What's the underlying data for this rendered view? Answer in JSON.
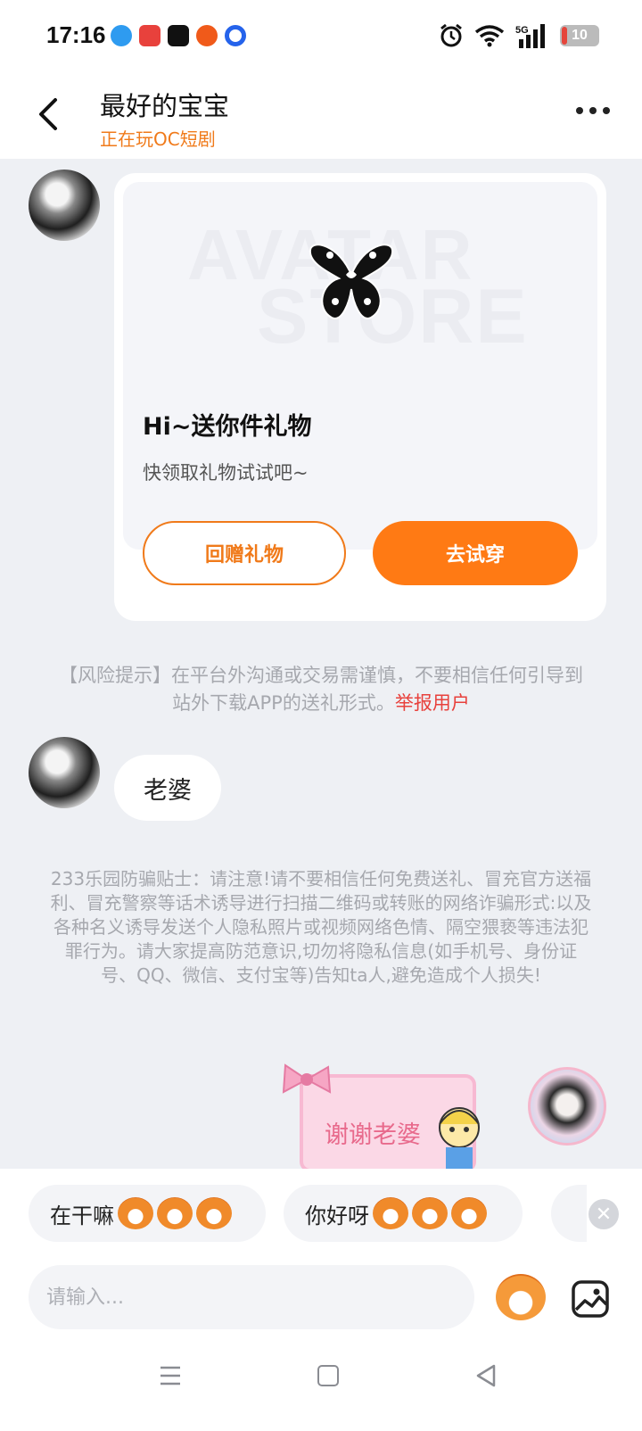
{
  "status_bar": {
    "time": "17:16",
    "battery": "10",
    "network": "5G"
  },
  "header": {
    "title": "最好的宝宝",
    "subtitle": "正在玩OC短剧"
  },
  "gift_card": {
    "banner_words": [
      "AVATAR",
      "STORE"
    ],
    "title": "Hi~送你件礼物",
    "description": "快领取礼物试试吧~",
    "return_gift_label": "回赠礼物",
    "try_on_label": "去试穿"
  },
  "risk_notice": {
    "text": "【风险提示】在平台外沟通或交易需谨慎，不要相信任何引导到站外下载APP的送礼形式。",
    "report_link": "举报用户"
  },
  "messages": {
    "incoming_text": "老婆",
    "sticker_text": "谢谢老婆"
  },
  "fraud_notice": "233乐园防骗贴士：请注意!请不要相信任何免费送礼、冒充官方送福利、冒充警察等话术诱导进行扫描二维码或转账的网络诈骗形式:以及各种名义诱导发送个人隐私照片或视频网络色情、隔空猥亵等违法犯罪行为。请大家提高防范意识,切勿将隐私信息(如手机号、身份证号、QQ、微信、支付宝等)告知ta人,避免造成个人损失!",
  "quick_replies": [
    {
      "label": "在干嘛"
    },
    {
      "label": "你好呀"
    }
  ],
  "input": {
    "placeholder": "请输入..."
  },
  "colors": {
    "accent": "#ff7a14",
    "report": "#e8413c",
    "background": "#eef0f4"
  }
}
